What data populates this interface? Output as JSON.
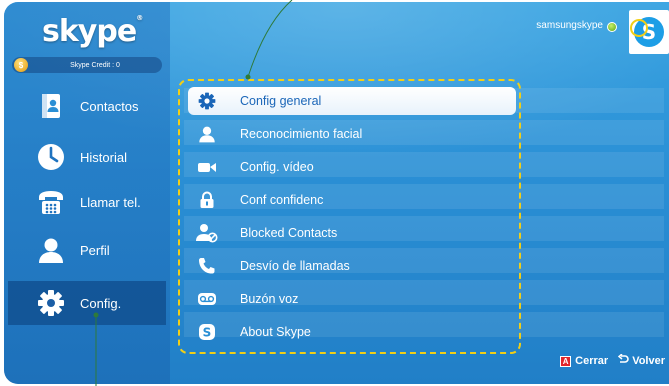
{
  "app": {
    "logo_text": "skype"
  },
  "credit": {
    "label": "Skype Credit : 0"
  },
  "user": {
    "name": "samsungskype"
  },
  "sidebar": {
    "items": [
      {
        "label": "Contactos",
        "icon": "contacts-book-icon"
      },
      {
        "label": "Historial",
        "icon": "clock-icon"
      },
      {
        "label": "Llamar tel.",
        "icon": "telephone-icon"
      },
      {
        "label": "Perfil",
        "icon": "person-icon"
      },
      {
        "label": "Config.",
        "icon": "gear-icon",
        "active": true
      }
    ]
  },
  "menu": {
    "items": [
      {
        "label": "Config general",
        "icon": "gear-icon",
        "selected": true
      },
      {
        "label": "Reconocimiento facial",
        "icon": "person-icon"
      },
      {
        "label": "Config. vídeo",
        "icon": "video-camera-icon"
      },
      {
        "label": "Conf confidenc",
        "icon": "lock-icon"
      },
      {
        "label": "Blocked Contacts",
        "icon": "blocked-user-icon"
      },
      {
        "label": "Desvío de llamadas",
        "icon": "phone-forward-icon"
      },
      {
        "label": "Buzón voz",
        "icon": "voicemail-icon"
      },
      {
        "label": "About Skype",
        "icon": "skype-logo-icon"
      }
    ]
  },
  "footer": {
    "close_key": "A",
    "close_label": "Cerrar",
    "back_label": "Volver"
  },
  "colors": {
    "background": "#2a8fd5",
    "highlight": "#f2cf16",
    "selected_text": "#1b66b8",
    "close_key": "#e0262b"
  }
}
